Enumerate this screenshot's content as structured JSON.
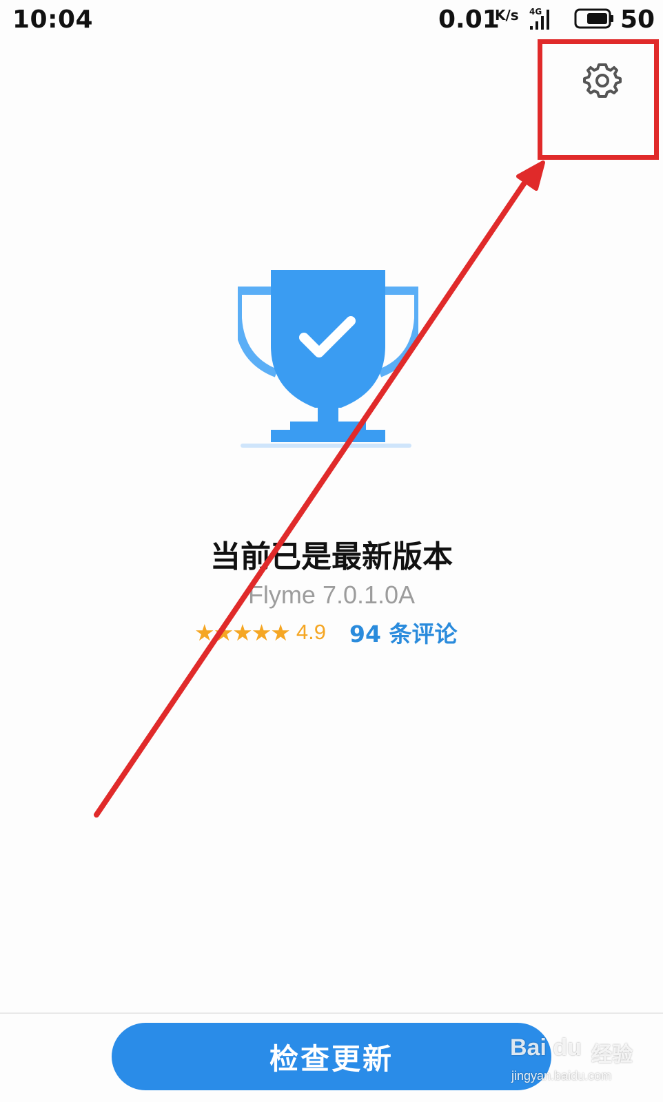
{
  "status_bar": {
    "time": "10:04",
    "net_speed": "0.01",
    "net_unit": "K/s",
    "network_type": "4G",
    "battery_level": "50"
  },
  "toolbar": {
    "settings_icon": "gear-icon"
  },
  "main": {
    "illustration_icon": "trophy-check-icon",
    "status_title": "当前已是最新版本",
    "version": "Flyme 7.0.1.0A",
    "rating": {
      "stars": "★★★★★",
      "star_count": 5,
      "score": "4.9",
      "reviews_link": "94 条评论"
    }
  },
  "footer": {
    "check_update_label": "检查更新"
  },
  "watermark": {
    "logo": "Bai du",
    "word": "经验",
    "url": "jingyan.baidu.com"
  },
  "annotation": {
    "color": "#e02a2a"
  },
  "colors": {
    "accent": "#2a8ce8",
    "trophy": "#3a9cf2",
    "star": "#f5a623",
    "link": "#2a8bdc"
  }
}
